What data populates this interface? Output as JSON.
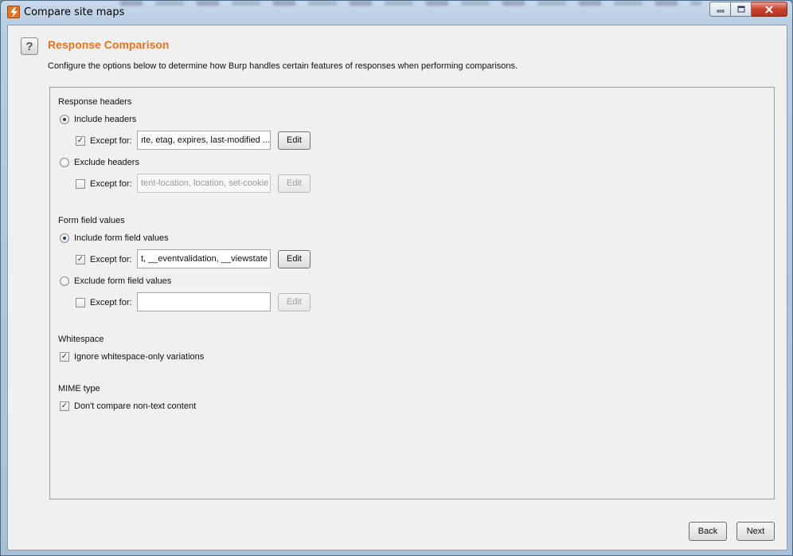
{
  "window": {
    "title": "Compare site maps",
    "minimize_icon": "minimize-icon",
    "maximize_icon": "maximize-icon",
    "close_icon": "close-icon"
  },
  "header": {
    "help_icon": "help-icon",
    "help_glyph": "?",
    "title": "Response Comparison",
    "description": "Configure the options below to determine how Burp handles certain features of responses when performing comparisons.",
    "accent_color": "#e8731f"
  },
  "response_headers": {
    "label": "Response headers",
    "include": {
      "label": "Include headers",
      "selected": true
    },
    "include_except": {
      "label": "Except for:",
      "checked": true,
      "value": "ıte, etag, expires, last-modified ...",
      "edit_label": "Edit",
      "enabled": true
    },
    "exclude": {
      "label": "Exclude headers",
      "selected": false
    },
    "exclude_except": {
      "label": "Except for:",
      "checked": false,
      "value": "tent-location, location, set-cookie",
      "edit_label": "Edit",
      "enabled": false
    }
  },
  "form_fields": {
    "label": "Form field values",
    "include": {
      "label": "Include form field values",
      "selected": true
    },
    "include_except": {
      "label": "Except for:",
      "checked": true,
      "value": "t, __eventvalidation, __viewstate",
      "edit_label": "Edit",
      "enabled": true
    },
    "exclude": {
      "label": "Exclude form field values",
      "selected": false
    },
    "exclude_except": {
      "label": "Except for:",
      "checked": false,
      "value": "",
      "edit_label": "Edit",
      "enabled": false
    }
  },
  "whitespace": {
    "label": "Whitespace",
    "ignore": {
      "label": "Ignore whitespace-only variations",
      "checked": true
    }
  },
  "mime": {
    "label": "MIME type",
    "non_text": {
      "label": "Don't compare non-text content",
      "checked": true
    }
  },
  "footer": {
    "back_label": "Back",
    "next_label": "Next"
  }
}
